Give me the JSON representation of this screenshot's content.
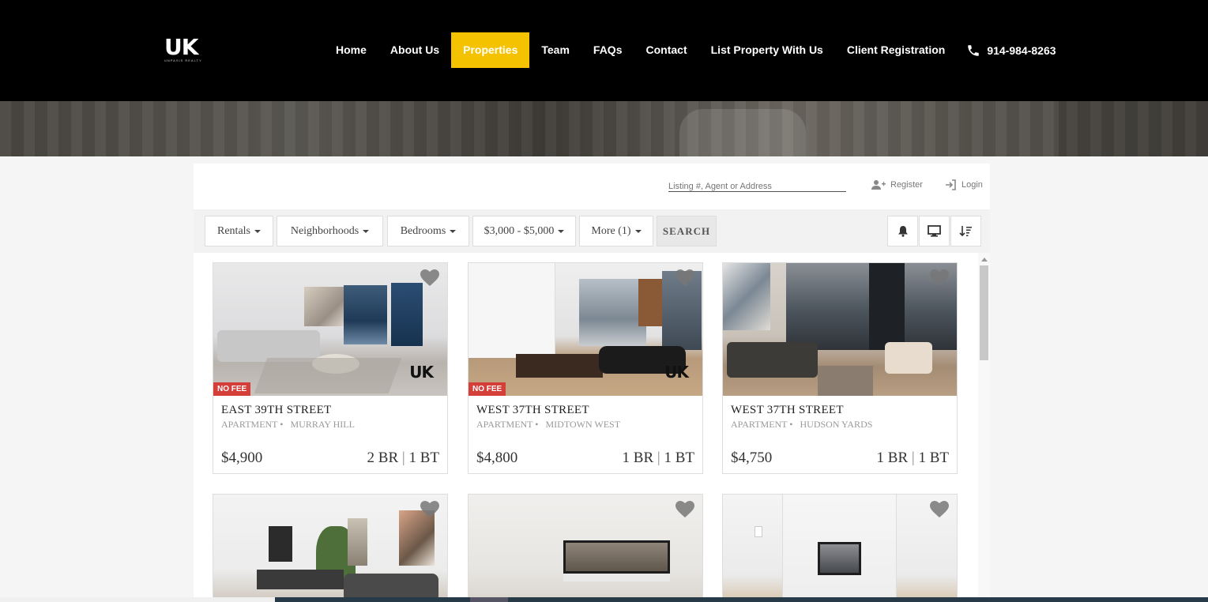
{
  "header": {
    "logo_mark": "UK",
    "logo_sub": "UNPASIS REALTY",
    "nav": [
      "Home",
      "About Us",
      "Properties",
      "Team",
      "FAQs",
      "Contact",
      "List Property With Us",
      "Client Registration"
    ],
    "active_nav": "Properties",
    "phone": "914-984-8263"
  },
  "colors": {
    "accent": "#f5c200",
    "nofee": "#d43f3a",
    "topbar": "#000000"
  },
  "search": {
    "placeholder": "Listing #, Agent or Address"
  },
  "account": {
    "register": "Register",
    "login": "Login"
  },
  "filters": {
    "type": "Rentals",
    "neighborhoods": "Neighborhoods",
    "bedrooms": "Bedrooms",
    "price": "$3,000 - $5,000",
    "more": "More (1)",
    "search_button": "SEARCH"
  },
  "tool_icons": [
    "bell-icon",
    "monitor-icon",
    "sort-icon"
  ],
  "listings": [
    {
      "badge": "NO FEE",
      "address": "EAST 39TH STREET",
      "type": "APARTMENT",
      "neighborhood": "MURRAY HILL",
      "price": "$4,900",
      "beds": "2 BR",
      "baths": "1 BT"
    },
    {
      "badge": "NO FEE",
      "address": "WEST 37TH STREET",
      "type": "APARTMENT",
      "neighborhood": "MIDTOWN WEST",
      "price": "$4,800",
      "beds": "1 BR",
      "baths": "1 BT"
    },
    {
      "badge": "",
      "address": "WEST 37TH STREET",
      "type": "APARTMENT",
      "neighborhood": "HUDSON YARDS",
      "price": "$4,750",
      "beds": "1 BR",
      "baths": "1 BT"
    },
    {
      "badge": "",
      "address": "",
      "type": "",
      "neighborhood": "",
      "price": "",
      "beds": "",
      "baths": ""
    },
    {
      "badge": "",
      "address": "",
      "type": "",
      "neighborhood": "",
      "price": "",
      "beds": "",
      "baths": ""
    },
    {
      "badge": "",
      "address": "",
      "type": "",
      "neighborhood": "",
      "price": "",
      "beds": "",
      "baths": ""
    }
  ],
  "separators": {
    "dot": "•",
    "pipe": "|"
  }
}
